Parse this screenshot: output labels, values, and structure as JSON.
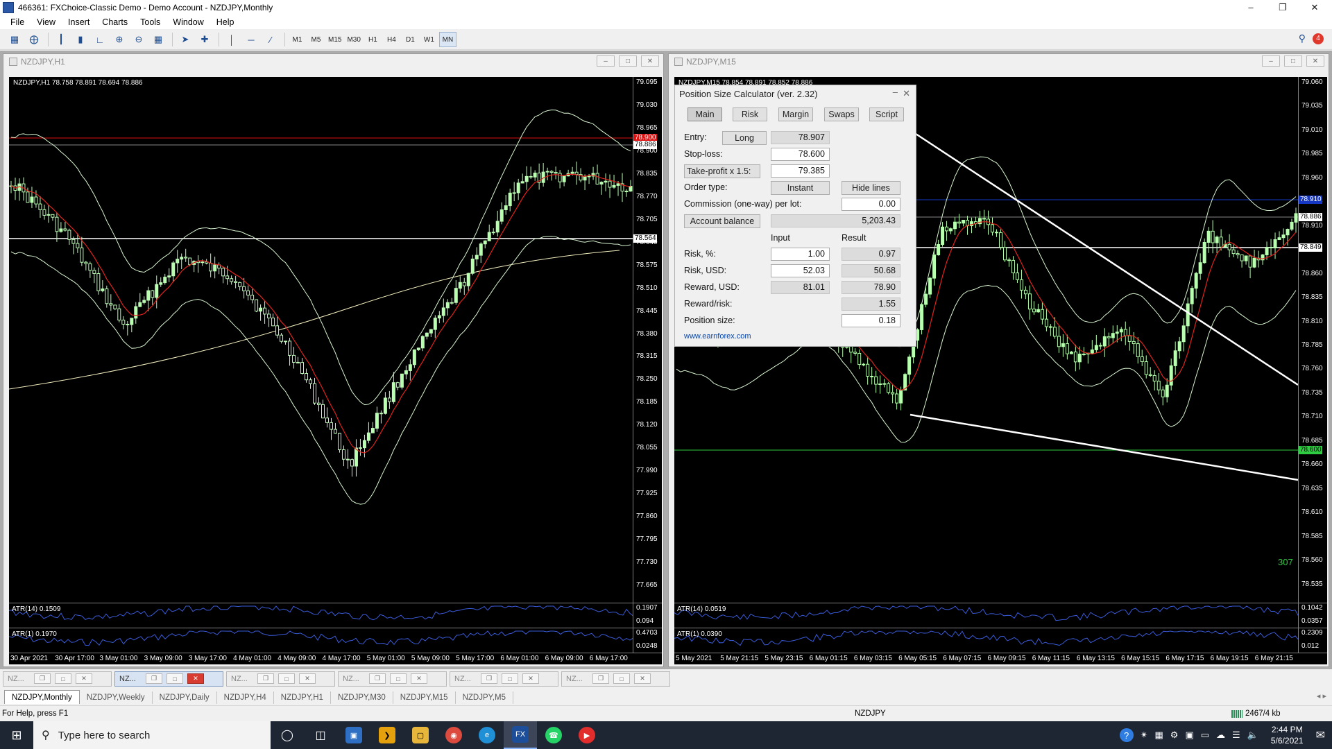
{
  "titlebar": {
    "title": "466361: FXChoice-Classic Demo - Demo Account - NZDJPY,Monthly"
  },
  "menu": [
    "File",
    "View",
    "Insert",
    "Charts",
    "Tools",
    "Window",
    "Help"
  ],
  "timeframes": [
    "M1",
    "M5",
    "M15",
    "M30",
    "H1",
    "H4",
    "D1",
    "W1",
    "MN"
  ],
  "active_timeframe": "MN",
  "alerts_count": "4",
  "left_chart": {
    "window_title": "NZDJPY,H1",
    "header": "NZDJPY,H1  78.758 78.891 78.694 78.886",
    "price_ticks": [
      "79.095",
      "79.030",
      "78.965",
      "78.900",
      "78.835",
      "78.770",
      "78.705",
      "78.640",
      "78.575",
      "78.510",
      "78.445",
      "78.380",
      "78.315",
      "78.250",
      "78.185",
      "78.120",
      "78.055",
      "77.990",
      "77.925",
      "77.860",
      "77.795",
      "77.730",
      "77.665"
    ],
    "tag_current": "78.886",
    "tag_ask": "78.900",
    "tag_line": "78.564",
    "atr14_label": "ATR(14) 0.1509",
    "atr14_ticks": [
      "0.1907",
      "0.094"
    ],
    "atr1_label": "ATR(1) 0.1970",
    "atr1_ticks": [
      "0.4703",
      "0.0248"
    ],
    "time_labels": [
      "30 Apr 2021",
      "30 Apr 17:00",
      "3 May 01:00",
      "3 May 09:00",
      "3 May 17:00",
      "4 May 01:00",
      "4 May 09:00",
      "4 May 17:00",
      "5 May 01:00",
      "5 May 09:00",
      "5 May 17:00",
      "6 May 01:00",
      "6 May 09:00",
      "6 May 17:00"
    ]
  },
  "right_chart": {
    "window_title": "NZDJPY,M15",
    "header": "NZDJPY,M15  78.854 78.891 78.852 78.886",
    "price_ticks": [
      "79.060",
      "79.035",
      "79.010",
      "78.985",
      "78.960",
      "78.935",
      "78.910",
      "78.885",
      "78.860",
      "78.835",
      "78.810",
      "78.785",
      "78.760",
      "78.735",
      "78.710",
      "78.685",
      "78.660",
      "78.635",
      "78.610",
      "78.585",
      "78.560",
      "78.535"
    ],
    "tag_current": "78.886",
    "tag_blue": "78.910",
    "tag_line": "78.849",
    "tag_stop": "78.600",
    "stop_label": "307",
    "atr14_label": "ATR(14) 0.0519",
    "atr14_ticks": [
      "0.1042",
      "0.0357"
    ],
    "atr1_label": "ATR(1) 0.0390",
    "atr1_ticks": [
      "0.2309",
      "0.012"
    ],
    "time_labels": [
      "5 May 2021",
      "5 May 21:15",
      "5 May 23:15",
      "6 May 01:15",
      "6 May 03:15",
      "6 May 05:15",
      "6 May 07:15",
      "6 May 09:15",
      "6 May 11:15",
      "6 May 13:15",
      "6 May 15:15",
      "6 May 17:15",
      "6 May 19:15",
      "6 May 21:15"
    ]
  },
  "psc": {
    "title": "Position Size Calculator (ver. 2.32)",
    "tabs": [
      "Main",
      "Risk",
      "Margin",
      "Swaps",
      "Script"
    ],
    "entry_label": "Entry:",
    "entry_dir": "Long",
    "entry_value": "78.907",
    "sl_label": "Stop-loss:",
    "sl_value": "78.600",
    "tp_label": "Take-profit x 1.5:",
    "tp_value": "79.385",
    "order_label": "Order type:",
    "order_btn": "Instant",
    "hide_btn": "Hide lines",
    "commission_label": "Commission (one-way) per lot:",
    "commission_value": "0.00",
    "balance_btn": "Account balance",
    "balance_value": "5,203.43",
    "col_input": "Input",
    "col_result": "Result",
    "risk_pct_label": "Risk, %:",
    "risk_pct_in": "1.00",
    "risk_pct_out": "0.97",
    "risk_usd_label": "Risk, USD:",
    "risk_usd_in": "52.03",
    "risk_usd_out": "50.68",
    "reward_label": "Reward, USD:",
    "reward_in": "81.01",
    "reward_out": "78.90",
    "rr_label": "Reward/risk:",
    "rr_out": "1.55",
    "pos_label": "Position size:",
    "pos_out": "0.18",
    "link": "www.earnforex.com"
  },
  "task_buttons": [
    "NZ...",
    "NZ...",
    "NZ...",
    "NZ...",
    "NZ...",
    "NZ..."
  ],
  "tabs": [
    "NZDJPY,Monthly",
    "NZDJPY,Weekly",
    "NZDJPY,Daily",
    "NZDJPY,H4",
    "NZDJPY,H1",
    "NZDJPY,M30",
    "NZDJPY,M15",
    "NZDJPY,M5"
  ],
  "status": {
    "help": "For Help, press F1",
    "symbol": "NZDJPY",
    "memory": "2467/4 kb"
  },
  "taskbar": {
    "search_placeholder": "Type here to search",
    "time": "2:44 PM",
    "date": "5/6/2021",
    "fx_label": "FX"
  }
}
